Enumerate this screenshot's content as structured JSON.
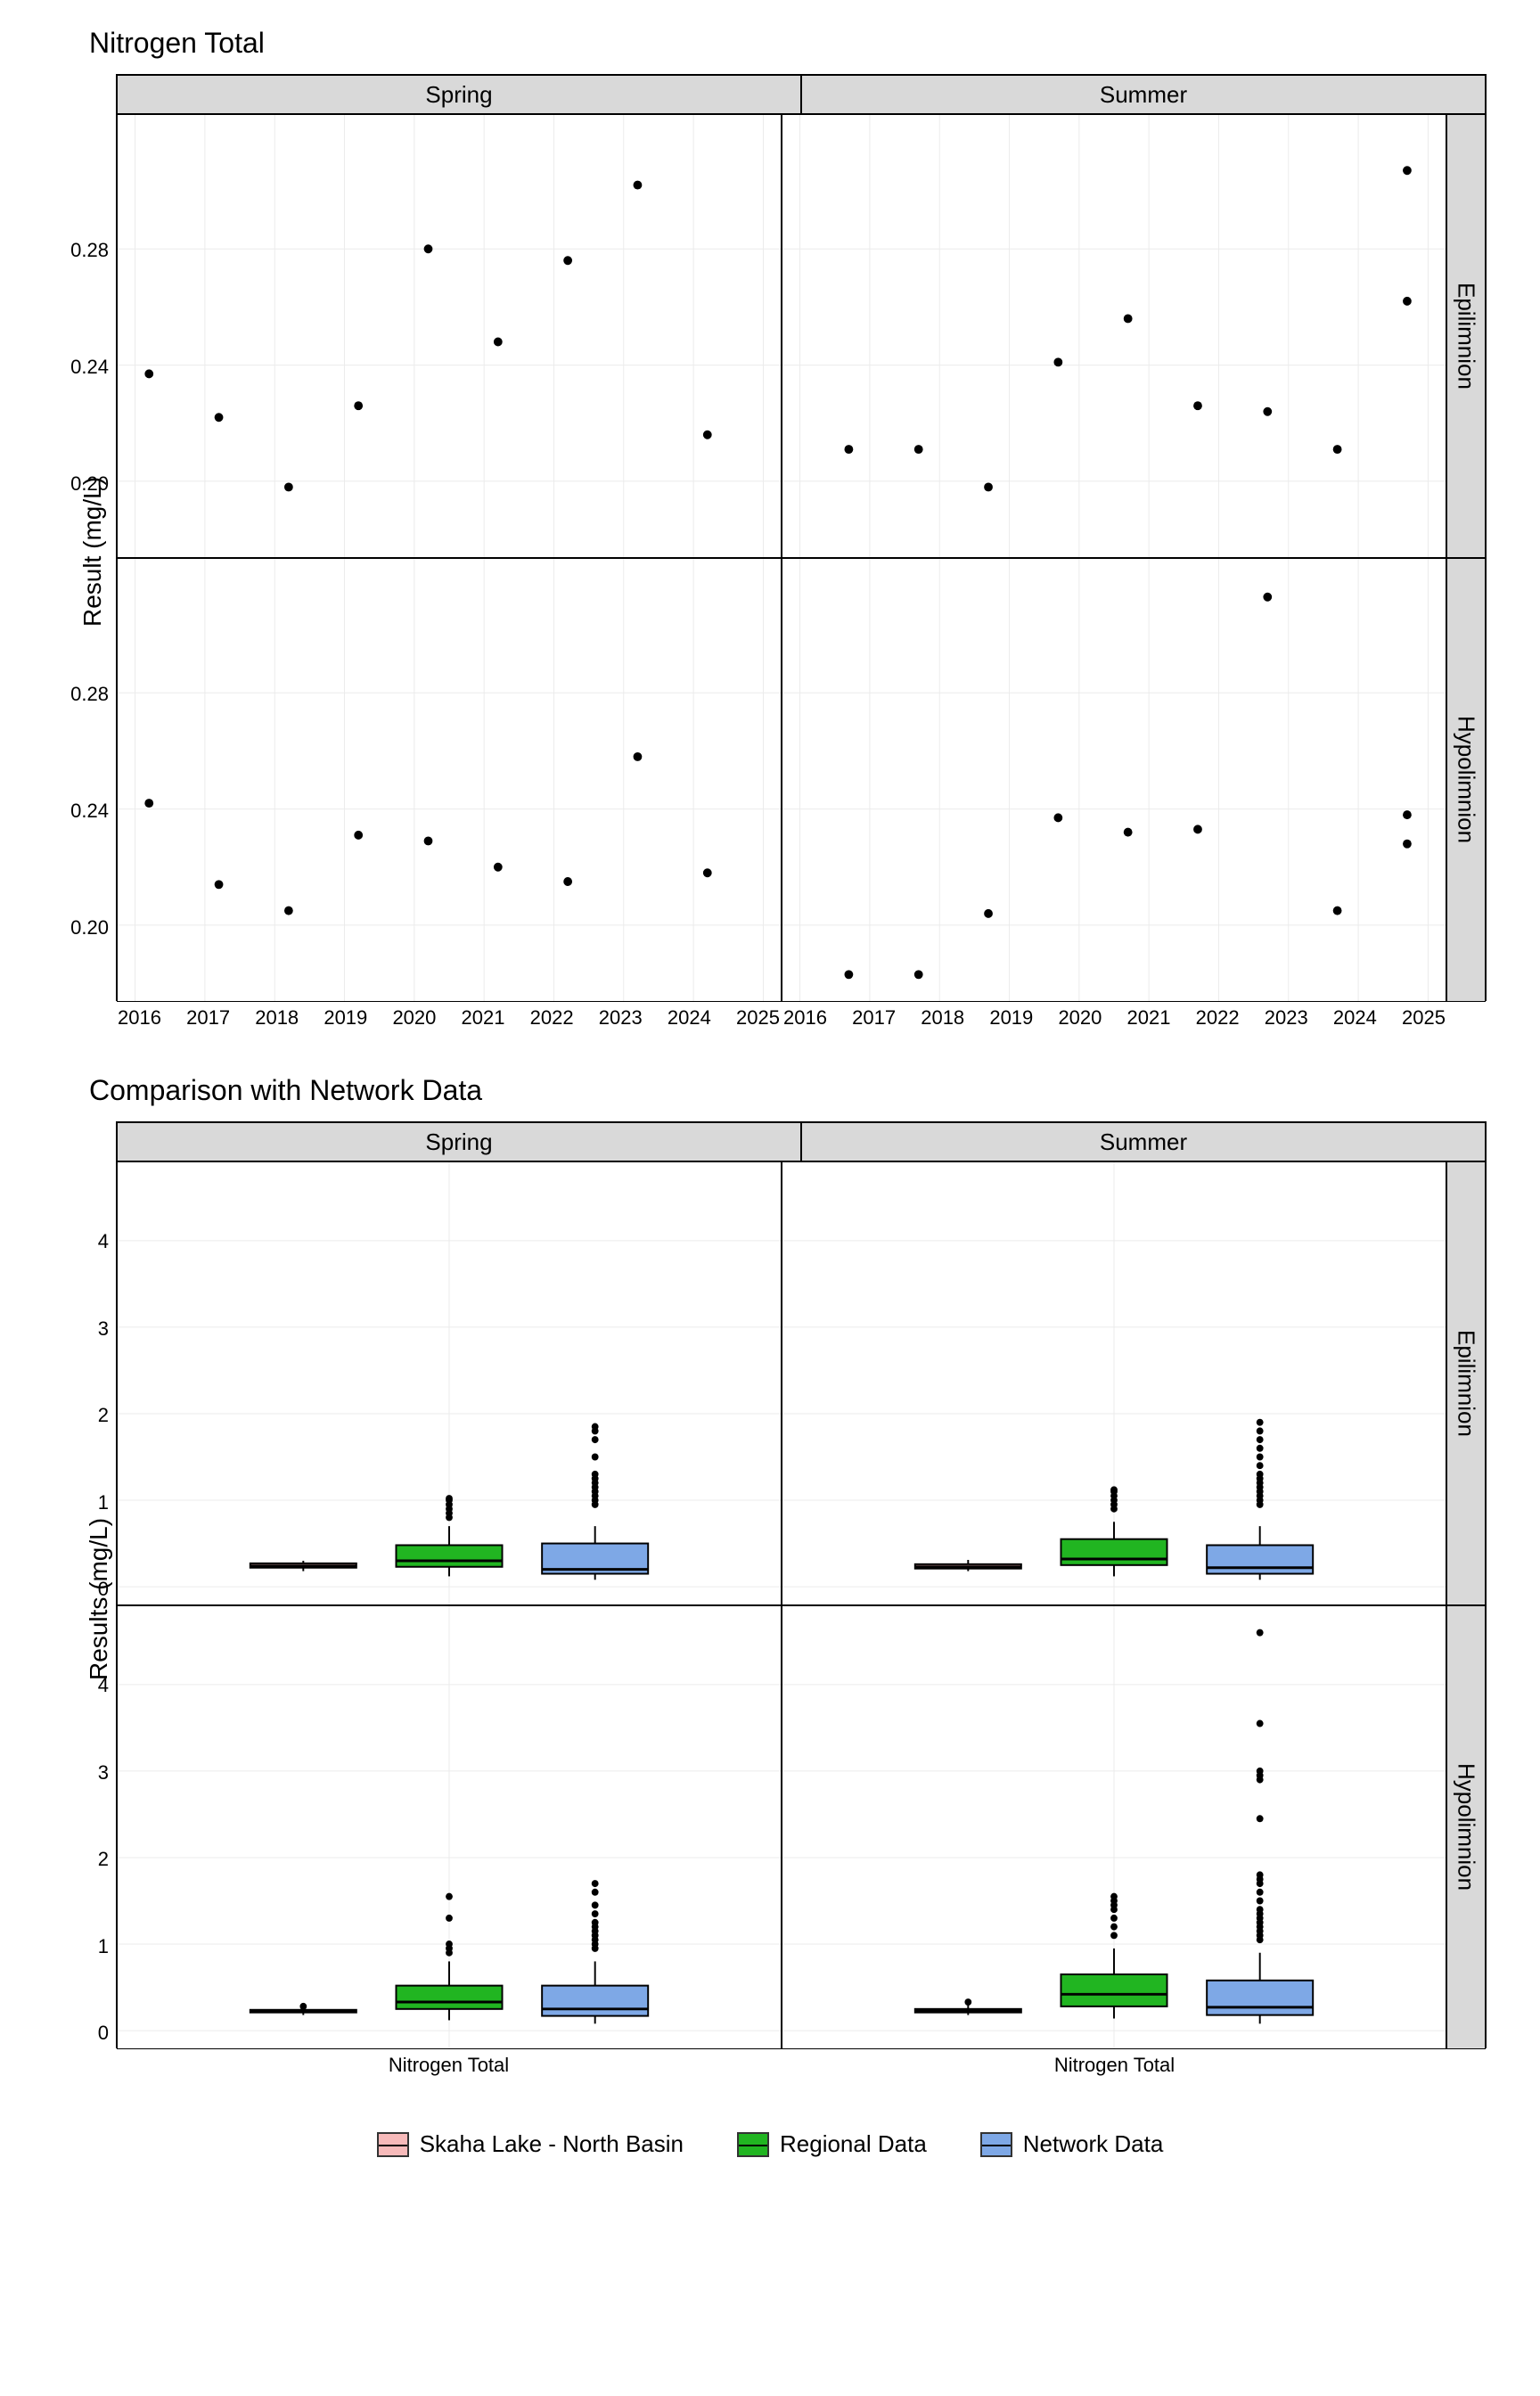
{
  "chart_data": [
    {
      "type": "scatter",
      "title": "Nitrogen Total",
      "ylabel": "Result (mg/L)",
      "ylim": [
        0.18,
        0.32
      ],
      "y_ticks": [
        0.2,
        0.24,
        0.28
      ],
      "xlim": [
        2016,
        2025
      ],
      "x_ticks": [
        2016,
        2017,
        2018,
        2019,
        2020,
        2021,
        2022,
        2023,
        2024,
        2025
      ],
      "facets_col": [
        "Spring",
        "Summer"
      ],
      "facets_row": [
        "Epilimnion",
        "Hypolimnion"
      ],
      "panels": {
        "Spring|Epilimnion": {
          "x": [
            2016.2,
            2017.2,
            2018.2,
            2019.2,
            2020.2,
            2021.2,
            2022.2,
            2023.2,
            2024.2
          ],
          "y": [
            0.237,
            0.222,
            0.198,
            0.226,
            0.28,
            0.248,
            0.276,
            0.302,
            0.216
          ]
        },
        "Summer|Epilimnion": {
          "x": [
            2016.7,
            2017.7,
            2018.7,
            2019.7,
            2020.7,
            2021.7,
            2022.7,
            2023.7,
            2024.7
          ],
          "y": [
            0.211,
            0.211,
            0.198,
            0.241,
            0.256,
            0.226,
            0.224,
            0.211,
            0.262,
            0.307
          ],
          "x_extra": [
            2024.7
          ]
        },
        "Spring|Hypolimnion": {
          "x": [
            2016.2,
            2017.2,
            2018.2,
            2019.2,
            2020.2,
            2021.2,
            2022.2,
            2023.2,
            2024.2
          ],
          "y": [
            0.242,
            0.214,
            0.205,
            0.231,
            0.229,
            0.22,
            0.215,
            0.258,
            0.218
          ]
        },
        "Summer|Hypolimnion": {
          "x": [
            2016.7,
            2017.7,
            2018.7,
            2019.7,
            2020.7,
            2021.7,
            2022.7,
            2023.7,
            2024.7
          ],
          "y": [
            0.183,
            0.183,
            0.204,
            0.237,
            0.232,
            0.233,
            0.313,
            0.205,
            0.228,
            0.238
          ],
          "x_extra": [
            2024.7
          ]
        }
      }
    },
    {
      "type": "box",
      "title": "Comparison with Network Data",
      "ylabel": "Results (mg/L)",
      "xlabel": "Nitrogen Total",
      "ylim": [
        0,
        4.7
      ],
      "y_ticks": [
        0,
        1,
        2,
        3,
        4
      ],
      "facets_col": [
        "Spring",
        "Summer"
      ],
      "facets_row": [
        "Epilimnion",
        "Hypolimnion"
      ],
      "series": [
        {
          "name": "Skaha Lake - North Basin",
          "color": "#f7baba"
        },
        {
          "name": "Regional Data",
          "color": "#21b521"
        },
        {
          "name": "Network Data",
          "color": "#7ea8e6"
        }
      ],
      "panels": {
        "Spring|Epilimnion": {
          "boxes": [
            {
              "min": 0.18,
              "q1": 0.22,
              "med": 0.24,
              "q3": 0.27,
              "max": 0.3,
              "outliers": []
            },
            {
              "min": 0.12,
              "q1": 0.23,
              "med": 0.3,
              "q3": 0.48,
              "max": 0.7,
              "outliers": [
                0.8,
                0.85,
                0.9,
                0.95,
                1.0,
                1.02
              ]
            },
            {
              "min": 0.08,
              "q1": 0.15,
              "med": 0.2,
              "q3": 0.5,
              "max": 0.7,
              "outliers": [
                0.95,
                1.0,
                1.05,
                1.1,
                1.15,
                1.2,
                1.25,
                1.3,
                1.5,
                1.7,
                1.8,
                1.85
              ]
            }
          ]
        },
        "Summer|Epilimnion": {
          "boxes": [
            {
              "min": 0.18,
              "q1": 0.21,
              "med": 0.23,
              "q3": 0.26,
              "max": 0.31,
              "outliers": []
            },
            {
              "min": 0.12,
              "q1": 0.25,
              "med": 0.32,
              "q3": 0.55,
              "max": 0.75,
              "outliers": [
                0.9,
                0.95,
                1.0,
                1.05,
                1.1,
                1.12
              ]
            },
            {
              "min": 0.08,
              "q1": 0.15,
              "med": 0.22,
              "q3": 0.48,
              "max": 0.7,
              "outliers": [
                0.95,
                1.0,
                1.05,
                1.1,
                1.15,
                1.2,
                1.25,
                1.3,
                1.4,
                1.5,
                1.6,
                1.7,
                1.8,
                1.9
              ]
            }
          ]
        },
        "Spring|Hypolimnion": {
          "boxes": [
            {
              "min": 0.18,
              "q1": 0.21,
              "med": 0.22,
              "q3": 0.24,
              "max": 0.26,
              "outliers": [
                0.28
              ]
            },
            {
              "min": 0.12,
              "q1": 0.25,
              "med": 0.33,
              "q3": 0.52,
              "max": 0.8,
              "outliers": [
                0.9,
                0.95,
                1.0,
                1.3,
                1.55
              ]
            },
            {
              "min": 0.08,
              "q1": 0.17,
              "med": 0.25,
              "q3": 0.52,
              "max": 0.8,
              "outliers": [
                0.95,
                1.0,
                1.05,
                1.1,
                1.15,
                1.2,
                1.25,
                1.35,
                1.45,
                1.6,
                1.7
              ]
            }
          ]
        },
        "Summer|Hypolimnion": {
          "boxes": [
            {
              "min": 0.18,
              "q1": 0.21,
              "med": 0.23,
              "q3": 0.25,
              "max": 0.31,
              "outliers": [
                0.33
              ]
            },
            {
              "min": 0.14,
              "q1": 0.28,
              "med": 0.42,
              "q3": 0.65,
              "max": 0.95,
              "outliers": [
                1.1,
                1.2,
                1.3,
                1.4,
                1.45,
                1.5,
                1.55
              ]
            },
            {
              "min": 0.08,
              "q1": 0.18,
              "med": 0.27,
              "q3": 0.58,
              "max": 0.9,
              "outliers": [
                1.05,
                1.1,
                1.15,
                1.2,
                1.25,
                1.3,
                1.35,
                1.4,
                1.5,
                1.6,
                1.7,
                1.75,
                1.8,
                2.45,
                2.9,
                2.95,
                3.0,
                3.55,
                4.6
              ]
            }
          ]
        }
      }
    }
  ],
  "legend": {
    "items": [
      {
        "label": "Skaha Lake - North Basin",
        "color": "#f7baba"
      },
      {
        "label": "Regional Data",
        "color": "#21b521"
      },
      {
        "label": "Network Data",
        "color": "#7ea8e6"
      }
    ]
  }
}
